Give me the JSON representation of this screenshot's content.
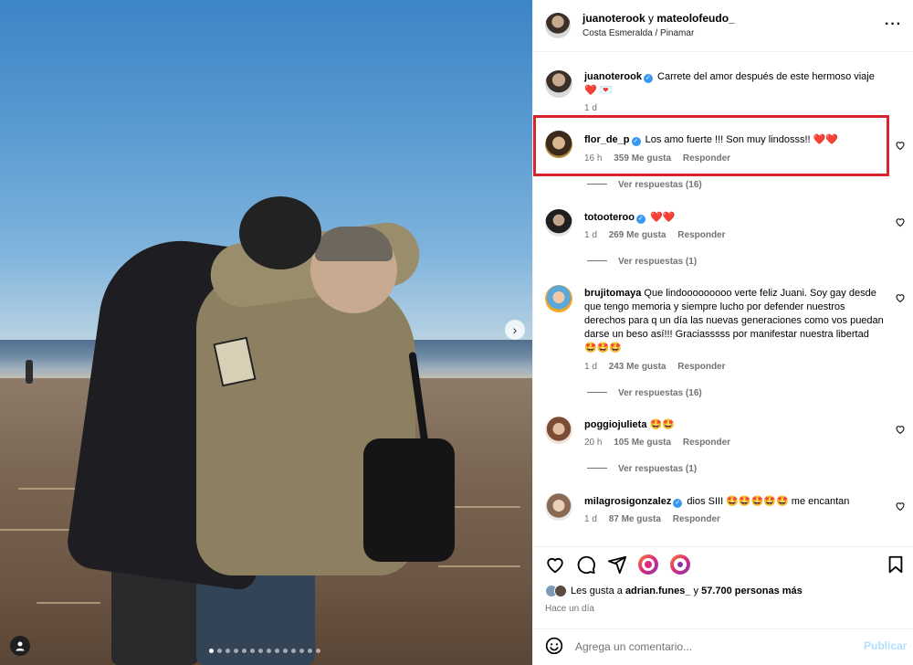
{
  "header": {
    "user1": "juanoterook",
    "conjunction": "y",
    "user2": "mateolofeudo_",
    "location": "Costa Esmeralda / Pinamar"
  },
  "caption": {
    "username": "juanoterook",
    "text": "Carrete del amor después de este hermoso viaje",
    "emoji": "❤️ 💌",
    "time": "1 d"
  },
  "comments": [
    {
      "username": "flor_de_p",
      "verified": true,
      "text": "Los amo fuerte !!! Son muy lindosss!!",
      "emoji": "❤️❤️",
      "time": "16 h",
      "likes": "359 Me gusta",
      "reply": "Responder",
      "replies": "Ver respuestas (16)"
    },
    {
      "username": "totooteroo",
      "verified": true,
      "text": "",
      "emoji": "❤️❤️",
      "time": "1 d",
      "likes": "269 Me gusta",
      "reply": "Responder",
      "replies": "Ver respuestas (1)"
    },
    {
      "username": "brujitomaya",
      "verified": false,
      "text": "Que lindooooooooo verte feliz Juani. Soy gay desde que tengo memoria y siempre lucho por defender nuestros derechos para q un día las nuevas generaciones como vos puedan darse un beso así!!! Graciasssss por manifestar nuestra libertad",
      "emoji": "🤩🤩🤩",
      "time": "1 d",
      "likes": "243 Me gusta",
      "reply": "Responder",
      "replies": "Ver respuestas (16)"
    },
    {
      "username": "poggiojulieta",
      "verified": false,
      "text": "",
      "emoji": "🤩🤩",
      "time": "20 h",
      "likes": "105 Me gusta",
      "reply": "Responder",
      "replies": "Ver respuestas (1)"
    },
    {
      "username": "milagrosigonzalez",
      "verified": true,
      "text": "dios SIII",
      "emoji": "🤩🤩🤩🤩🤩",
      "text2": "me encantan",
      "time": "1 d",
      "likes": "87 Me gusta",
      "reply": "Responder"
    }
  ],
  "likes": {
    "prefix": "Les gusta a",
    "user": "adrian.funes_",
    "middle": "y",
    "others": "57.700 personas más"
  },
  "posted": "Hace un día",
  "comment_box": {
    "placeholder": "Agrega un comentario...",
    "publish": "Publicar"
  },
  "icons": {
    "like": "heart-icon",
    "comment": "speech-bubble-icon",
    "share": "paper-plane-icon",
    "save": "bookmark-icon",
    "more": "ellipsis-icon",
    "next": "chevron-right-icon",
    "tags": "user-icon",
    "emoji": "smiley-icon"
  },
  "colors": {
    "highlight": "#d9232d",
    "verified": "#3897f0",
    "secondary_text": "#737373",
    "publish_disabled": "#b2dffc"
  }
}
